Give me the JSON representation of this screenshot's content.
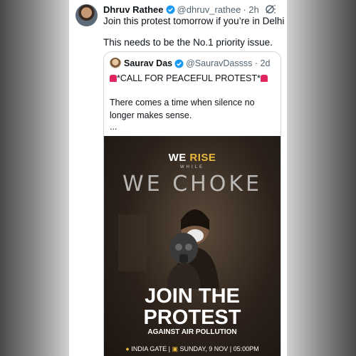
{
  "tweet": {
    "name": "Dhruv Rathee",
    "handle": "@dhruv_rathee",
    "time": "· 2h",
    "line1": "Join this protest tomorrow if you’re in Delhi",
    "line2": "This needs to be the No.1 priority issue."
  },
  "quote": {
    "name": "Saurav Das",
    "handle": "@SauravDassss · 2d",
    "line1": "*CALL FOR PEACEFUL PROTEST*",
    "line2": "There comes a time when silence no",
    "line3": "longer makes sense.",
    "line4": "..."
  },
  "poster": {
    "we": "WE ",
    "rise": "RISE",
    "while": "WHILE",
    "choke": "WE CHOKE",
    "join": "JOIN THE",
    "protest": "PROTEST",
    "against": "AGAINST AIR POLLUTION",
    "location": "INDIA GATE | ",
    "date": "SUNDAY, 9 NOV | 05:00PM"
  },
  "colors": {
    "verified": "#1d9bf0",
    "accent": "#e8b93c"
  },
  "icons": {
    "verified": "verified-badge-icon",
    "grok": "grok-icon",
    "more": "more-icon",
    "siren": "siren-icon",
    "location": "location-pin-icon",
    "calendar": "calendar-icon"
  }
}
